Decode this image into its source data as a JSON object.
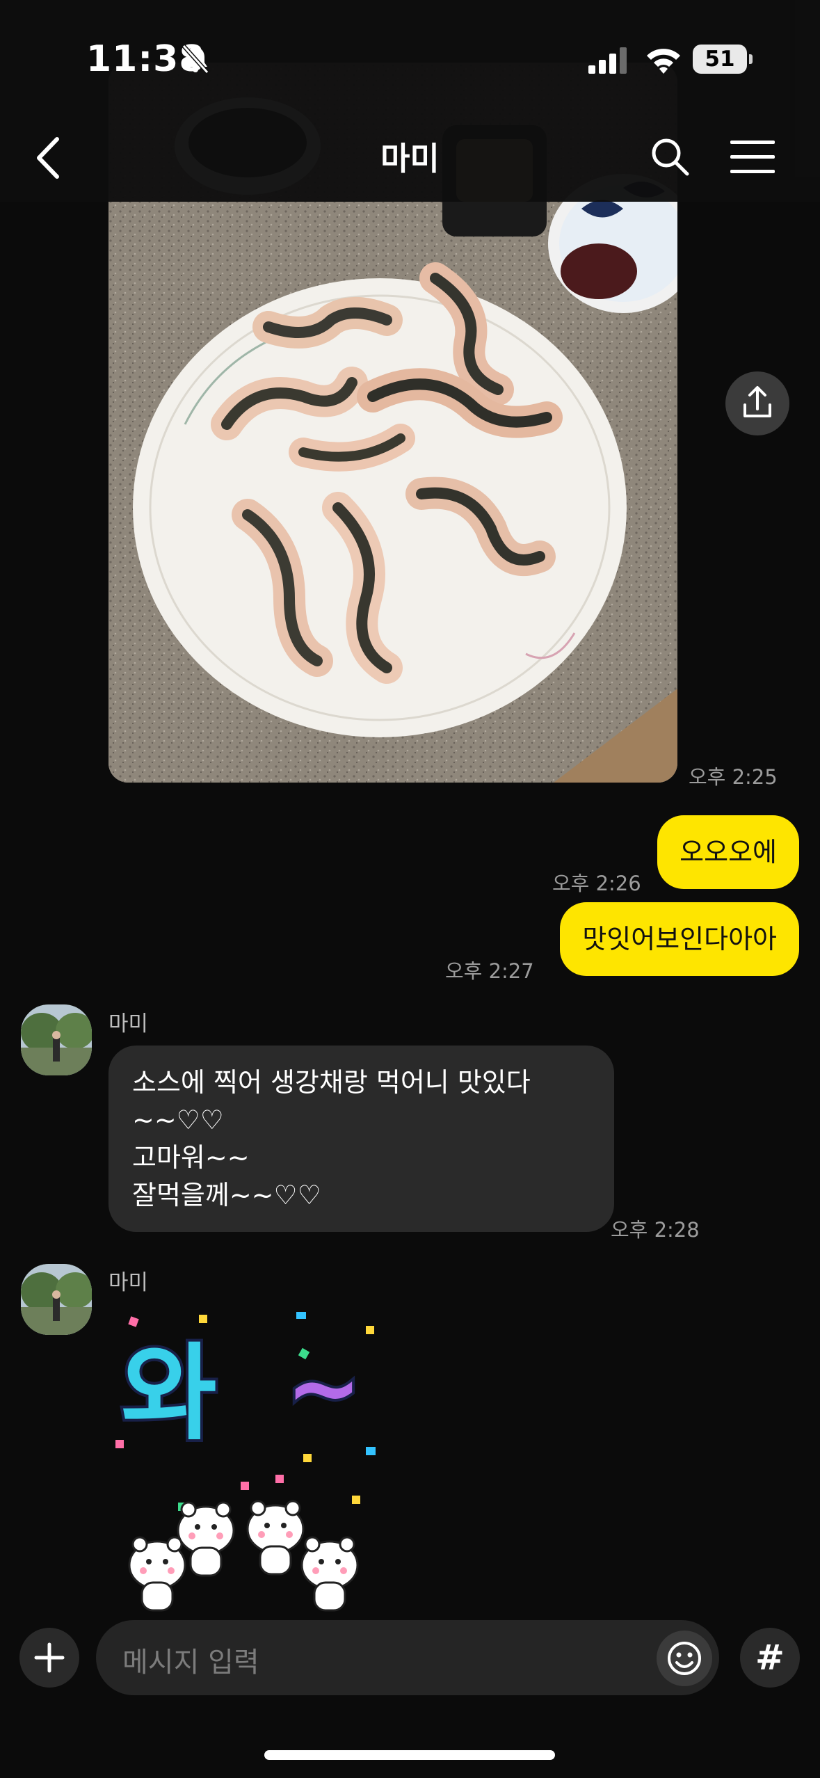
{
  "status": {
    "time": "11:38",
    "battery": "51"
  },
  "header": {
    "title": "마미"
  },
  "messages": {
    "photo_time": "오후 2:25",
    "me1": {
      "text": "오오오에",
      "time": "오후 2:26"
    },
    "me2": {
      "text": "맛잇어보인다아아",
      "time": "오후 2:27"
    },
    "other1": {
      "sender": "마미",
      "lines": [
        "소스에 찍어 생강채랑  먹어니 맛있다",
        "~~♡♡",
        "고마워~~",
        "잘먹을께~~♡♡"
      ],
      "time": "오후 2:28"
    },
    "other2": {
      "sender": "마미",
      "sticker_text": "와~"
    }
  },
  "composer": {
    "placeholder": "메시지 입력",
    "hash_label": "#"
  },
  "colors": {
    "my_bubble": "#fee500",
    "other_bubble": "#2a2a2a",
    "background": "#0b0b0b"
  },
  "icons": [
    "back-icon",
    "search-icon",
    "menu-icon",
    "share-icon",
    "plus-icon",
    "emoji-icon",
    "hash-icon",
    "bell-off-icon",
    "signal-icon",
    "wifi-icon"
  ]
}
